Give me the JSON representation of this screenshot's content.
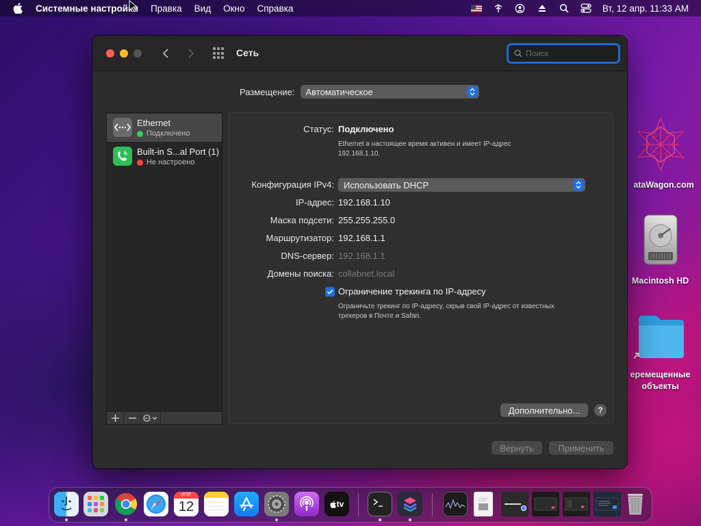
{
  "menubar": {
    "app_name": "Системные настройки",
    "items": [
      "Правка",
      "Вид",
      "Окно",
      "Справка"
    ],
    "clock": "Вт, 12 апр.  11:33 AM"
  },
  "window": {
    "title": "Сеть",
    "search_placeholder": "Поиск",
    "placement_label": "Размещение:",
    "placement_value": "Автоматическое"
  },
  "services": [
    {
      "name": "Ethernet",
      "status": "Подключено",
      "status_color": "#30d158"
    },
    {
      "name": "Built-in S...al Port (1)",
      "status": "Не настроено",
      "status_color": "#ff453a"
    }
  ],
  "details": {
    "status_label": "Статус:",
    "status_value": "Подключено",
    "status_desc_line1": "Ethernet в настоящее время активен и имеет IP-адрес",
    "status_desc_line2": "192.168.1.10.",
    "ipv4_label": "Конфигурация IPv4:",
    "ipv4_value": "Использовать DHCP",
    "ip_label": "IP-адрес:",
    "ip_value": "192.168.1.10",
    "mask_label": "Маска подсети:",
    "mask_value": "255.255.255.0",
    "router_label": "Маршрутизатор:",
    "router_value": "192.168.1.1",
    "dns_label": "DNS-сервер:",
    "dns_value": "192.168.1.1",
    "search_domains_label": "Домены поиска:",
    "search_domains_value": "collabnet.local",
    "tracking_checkbox_label": "Ограничение трекинга по IP-адресу",
    "tracking_checked": true,
    "tracking_desc_line1": "Ограничьте трекинг по IP-адресу, скрыв свой IP-адрес от известных",
    "tracking_desc_line2": "трекеров в Почте и Safari.",
    "advanced_button": "Дополнительно...",
    "help_button": "?"
  },
  "footer": {
    "revert_button": "Вернуть",
    "apply_button": "Применить"
  },
  "desktop": {
    "item1_label": "ataWagon.com",
    "item2_label": "Macintosh HD",
    "item3_label_line1": "еремещенные",
    "item3_label_line2": "объекты"
  },
  "dock": {
    "calendar_month": "АПР.",
    "calendar_day": "12",
    "tv_label": "tv"
  },
  "colors": {
    "accent": "#1f6fe0",
    "window_bg": "#2c2c2c"
  }
}
